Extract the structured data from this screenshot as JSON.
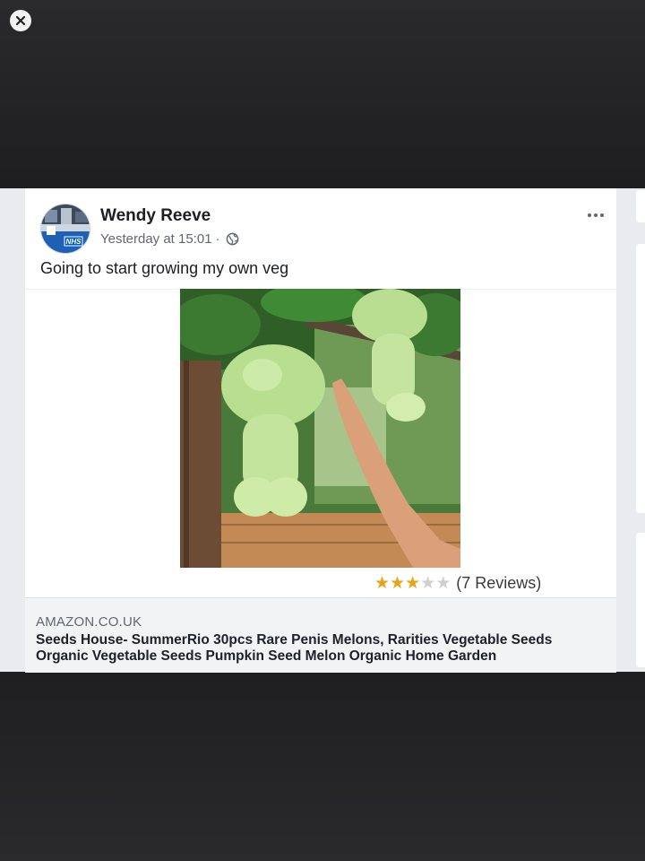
{
  "post": {
    "author": "Wendy Reeve",
    "timestamp": "Yesterday at 15:01",
    "separator": "·",
    "audience_icon": "globe-icon",
    "avatar_badge": "NHS",
    "text": "Going to start growing my own veg",
    "more_icon": "more-horizontal-icon"
  },
  "product_image": {
    "rating": 3,
    "rating_max": 5,
    "reviews_label": "(7 Reviews)"
  },
  "link_preview": {
    "domain": "AMAZON.CO.UK",
    "title": "Seeds House- SummerRio 30pcs Rare Penis Melons, Rarities Vegetable Seeds Organic Vegetable Seeds Pumpkin Seed Melon Organic Home Garden"
  },
  "viewer": {
    "close_icon": "close-icon"
  },
  "colors": {
    "star_filled": "#e8a317",
    "star_empty": "#cfcfcf",
    "backdrop": "#232326"
  }
}
